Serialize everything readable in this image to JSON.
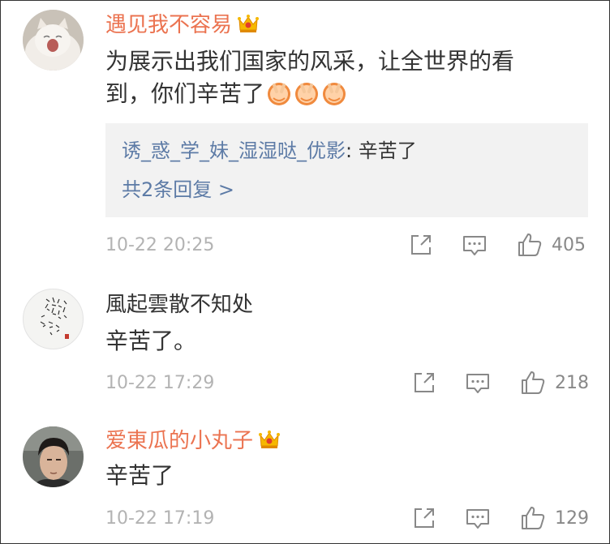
{
  "comments": [
    {
      "username": "遇见我不容易",
      "vip": true,
      "text_line1": "为展示出我们国家的风采，让全世界的看",
      "text_line2": "到，你们辛苦了",
      "emoji_count": 3,
      "emoji_name": "clasped-hands-emoji",
      "reply": {
        "user": "诱_惑_学_妹_湿湿哒_优影",
        "separator": ": ",
        "text": "辛苦了",
        "more": "共2条回复 >"
      },
      "timestamp": "10-22 20:25",
      "likes": "405"
    },
    {
      "username": "風起雲散不知处",
      "vip": false,
      "text_line1": "辛苦了。",
      "timestamp": "10-22 17:29",
      "likes": "218"
    },
    {
      "username": "爱東瓜的小丸子",
      "vip": true,
      "text_line1": "辛苦了",
      "timestamp": "10-22 17:19",
      "likes": "129"
    }
  ],
  "icons": {
    "share": "share-icon",
    "comment": "comment-icon",
    "like": "like-icon",
    "crown": "vip-crown-icon"
  },
  "colors": {
    "vip_name": "#eb7350",
    "link": "#5d7ba6",
    "meta": "#b3b3b3",
    "reply_bg": "#f2f2f2"
  }
}
